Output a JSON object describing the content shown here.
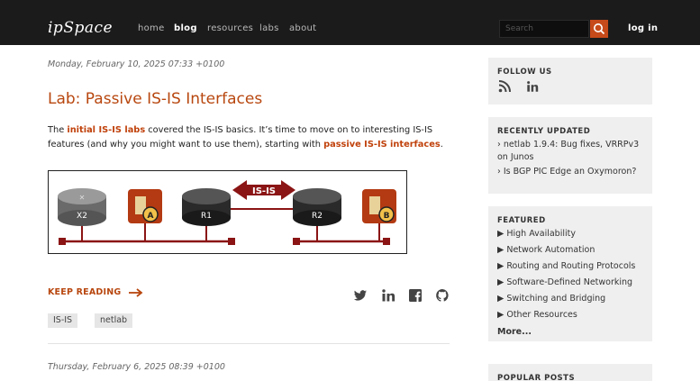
{
  "header": {
    "logo": "ipSpace",
    "nav": [
      {
        "label": "home",
        "active": false
      },
      {
        "label": "blog",
        "active": true
      },
      {
        "label": "resources",
        "active": false
      },
      {
        "label": "labs",
        "active": false
      },
      {
        "label": "about",
        "active": false
      }
    ],
    "search_placeholder": "Search",
    "login_label": "log in"
  },
  "post": {
    "date": "Monday, February 10, 2025 07:33 +0100",
    "title": "Lab: Passive IS-IS Interfaces",
    "intro": {
      "before": "The ",
      "link1": "initial IS-IS labs",
      "middle": " covered the IS-IS basics. It’s time to move on to interesting IS-IS features (and why you might want to use them), starting with ",
      "link2": "passive IS-IS interfaces",
      "after": "."
    },
    "diagram": {
      "routers": [
        "X2",
        "R1",
        "R2"
      ],
      "hosts": [
        "A",
        "B"
      ],
      "protocol_label": "IS-IS"
    },
    "keep_reading": "KEEP READING",
    "tags": [
      "IS-IS",
      "netlab"
    ]
  },
  "next_post": {
    "date": "Thursday, February 6, 2025 08:39 +0100"
  },
  "sidebar": {
    "follow": {
      "title": "FOLLOW US"
    },
    "recent": {
      "title": "RECENTLY UPDATED",
      "items": [
        "netlab 1.9.4: Bug fixes, VRRPv3 on Junos",
        "Is BGP PIC Edge an Oxymoron?"
      ]
    },
    "featured": {
      "title": "FEATURED",
      "items": [
        "High Availability",
        "Network Automation",
        "Routing and Routing Protocols",
        "Software-Defined Networking",
        "Switching and Bridging",
        "Other Resources"
      ],
      "more": "More..."
    },
    "popular": {
      "title": "POPULAR POSTS"
    }
  },
  "colors": {
    "accent": "#b8470f",
    "topbar": "#1b1b1b",
    "sidebar_box": "#efefef",
    "diagram_red": "#8b1414"
  }
}
